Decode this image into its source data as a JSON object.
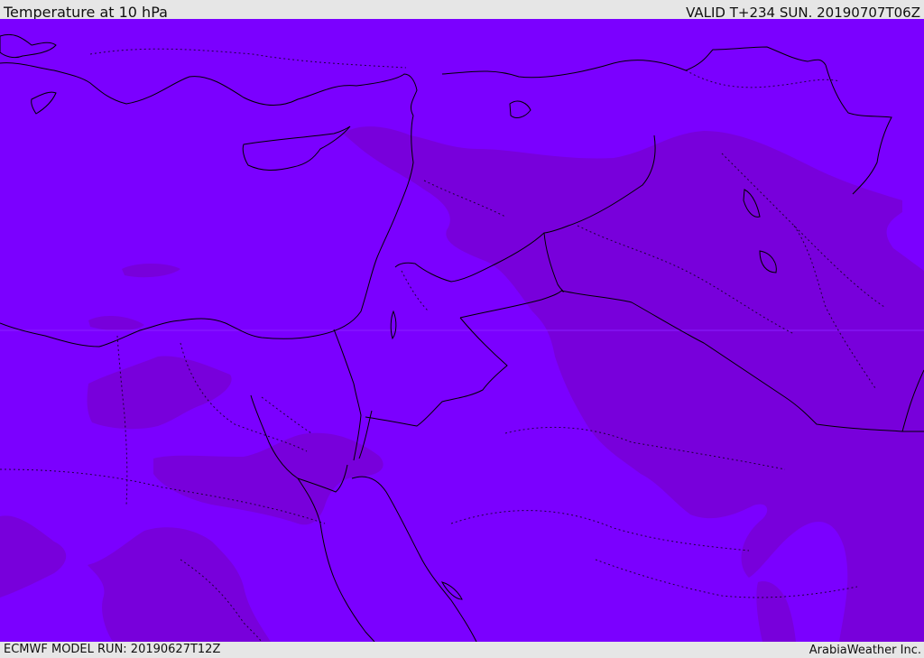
{
  "header": {
    "title": "Temperature at 10 hPa",
    "valid": "VALID T+234 SUN. 20190707T06Z"
  },
  "footer": {
    "model_run": "ECMWF MODEL RUN: 20190627T12Z",
    "credit": "ArabiaWeather Inc."
  },
  "map": {
    "colors": {
      "field_warm": "#7b00ff",
      "field_cool": "#7800db",
      "coastline": "#000000",
      "border": "#000000"
    }
  }
}
